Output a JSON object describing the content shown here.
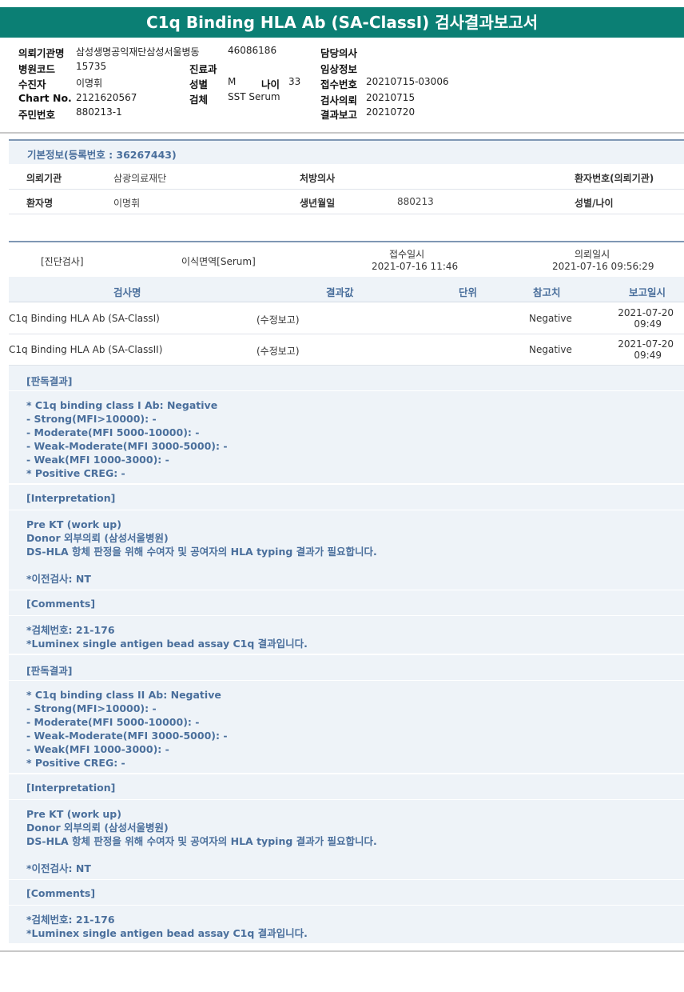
{
  "title": "C1q Binding HLA Ab (SA-ClassI) 검사결과보고서",
  "header": {
    "institution_label": "의뢰기관명",
    "institution_value": "삼성생명공익재단삼성서울병동",
    "inst_code": "46086186",
    "doctor_label": "담당의사",
    "hospital_code_label": "병원코드",
    "hospital_code_value": "15735",
    "dept_label": "진료과",
    "clinical_label": "임상정보",
    "patient_label": "수진자",
    "patient_value": "이명휘",
    "sex_label": "성별",
    "sex_value": "M",
    "age_label": "나이",
    "age_value": "33",
    "receipt_no_label": "접수번호",
    "receipt_no_value": "20210715-03006",
    "chart_label": "Chart No.",
    "chart_value": "2121620567",
    "specimen_label": "검체",
    "specimen_value": "SST Serum",
    "request_label": "검사의뢰",
    "request_value": "20210715",
    "rrn_label": "주민번호",
    "rrn_value": "880213-1",
    "report_label": "결과보고",
    "report_value": "20210720"
  },
  "basic_info": {
    "title": "기본정보(등록번호 : 36267443)",
    "inst_label": "의뢰기관",
    "inst_value": "삼광의료재단",
    "prescriber_label": "처방의사",
    "patient_no_label": "환자번호(의뢰기관)",
    "patient_name_label": "환자명",
    "patient_name_value": "이명휘",
    "dob_label": "생년월일",
    "dob_value": "880213",
    "sex_age_label": "성별/나이"
  },
  "record": {
    "category": "[진단검사]",
    "dept": "이식면역[Serum]",
    "received_label": "접수일시",
    "received_value": "2021-07-16  11:46",
    "requested_label": "의뢰일시",
    "requested_value": "2021-07-16  09:56:29"
  },
  "table": {
    "headers": [
      "검사명",
      "결과값",
      "단위",
      "참고치",
      "보고일시"
    ],
    "rows": [
      {
        "name": "C1q Binding HLA Ab (SA-ClassI)",
        "result": "(수정보고)",
        "unit": "",
        "ref": "Negative",
        "date": "2021-07-20",
        "time": "09:49"
      },
      {
        "name": "C1q Binding HLA Ab (SA-ClassII)",
        "result": "(수정보고)",
        "unit": "",
        "ref": "Negative",
        "date": "2021-07-20",
        "time": "09:49"
      }
    ]
  },
  "results": [
    {
      "heading": "[판독결과]",
      "body": "* C1q binding class I Ab: Negative\n- Strong(MFI>10000): -\n- Moderate(MFI 5000-10000): -\n- Weak-Moderate(MFI 3000-5000): -\n- Weak(MFI 1000-3000): -\n* Positive CREG: -"
    },
    {
      "heading": "[Interpretation]",
      "body": "Pre KT (work up)\nDonor 외부의뢰 (삼성서울병원)\nDS-HLA 항체 판정을 위해 수여자 및 공여자의 HLA typing 결과가 필요합니다.\n\n*이전검사: NT"
    },
    {
      "heading": "[Comments]",
      "body": "*검체번호: 21-176\n*Luminex single antigen bead assay C1q 결과입니다."
    },
    {
      "heading": "[판독결과]",
      "body": "* C1q binding class II Ab: Negative\n- Strong(MFI>10000): -\n- Moderate(MFI 5000-10000): -\n- Weak-Moderate(MFI 3000-5000): -\n- Weak(MFI 1000-3000): -\n* Positive CREG: -"
    },
    {
      "heading": "[Interpretation]",
      "body": "Pre KT (work up)\nDonor 외부의뢰 (삼성서울병원)\nDS-HLA 항체 판정을 위해 수여자 및 공여자의 HLA typing 결과가 필요합니다.\n\n*이전검사: NT"
    },
    {
      "heading": "[Comments]",
      "body": "*검체번호: 21-176\n*Luminex single antigen bead assay C1q 결과입니다."
    }
  ]
}
